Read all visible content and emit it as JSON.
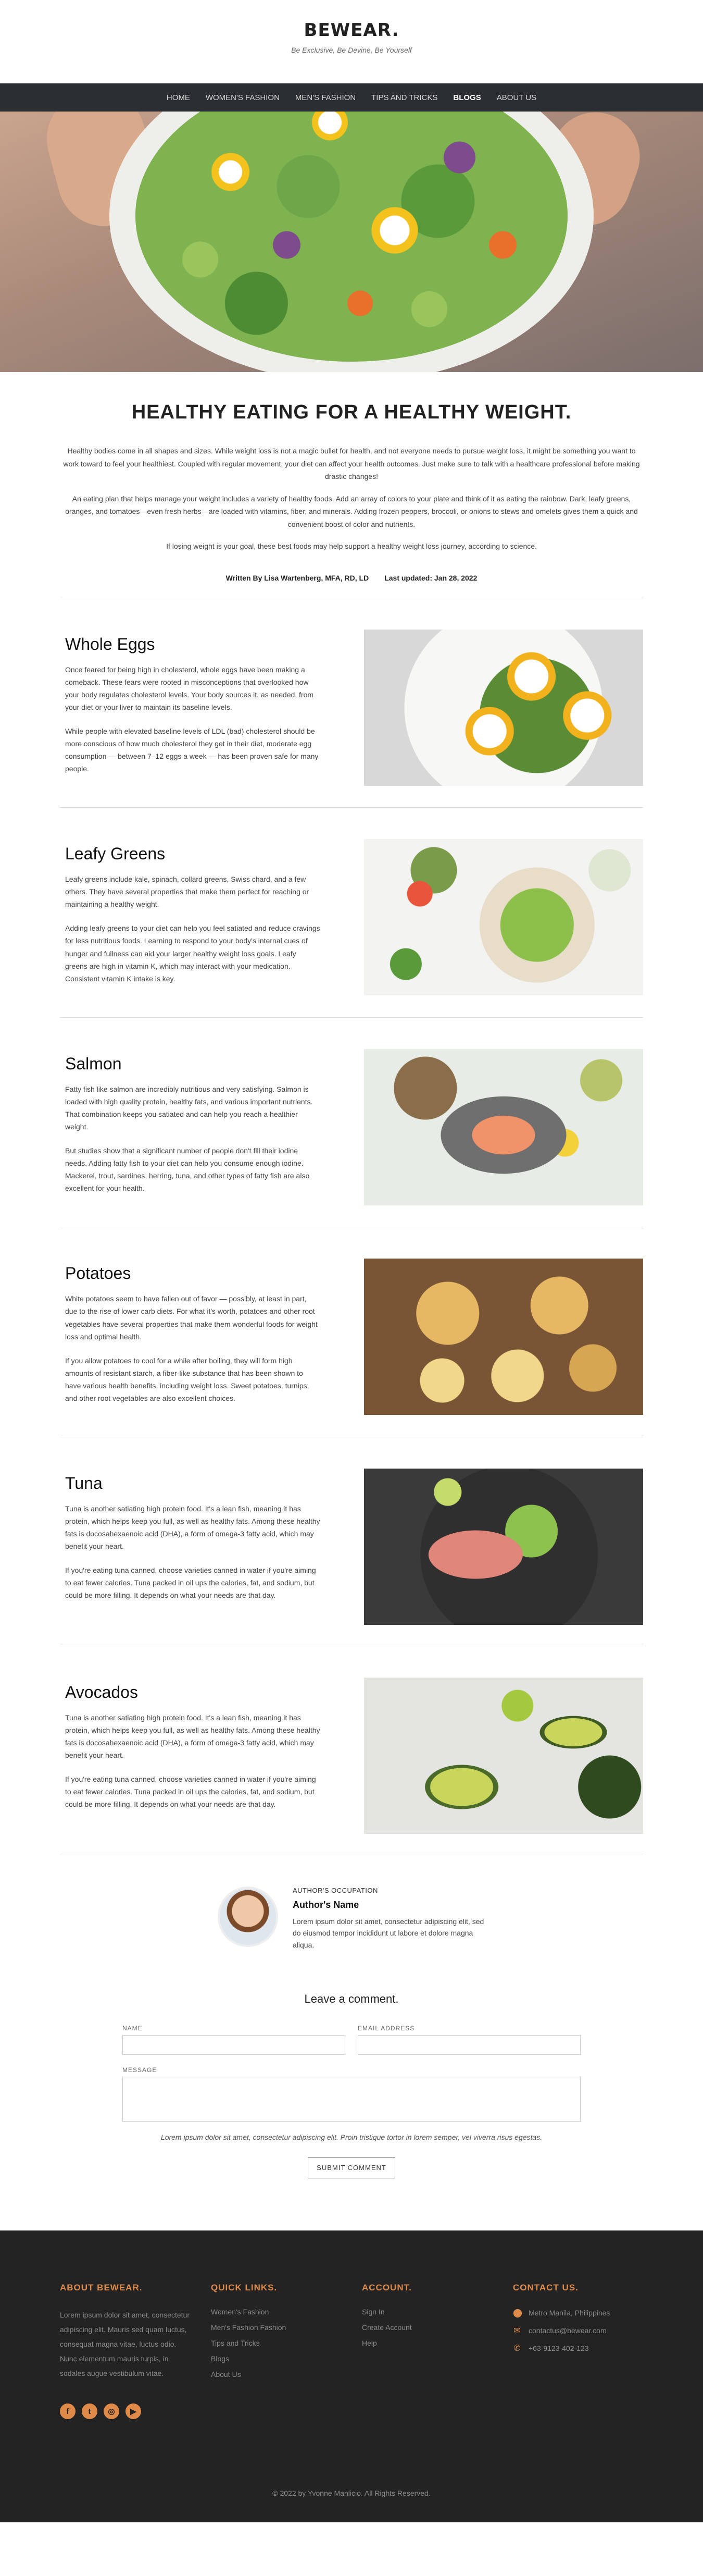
{
  "brand": {
    "title": "BEWEAR.",
    "tagline": "Be Exclusive, Be Devine, Be Yourself"
  },
  "nav": {
    "items": [
      {
        "label": "HOME"
      },
      {
        "label": "WOMEN'S FASHION"
      },
      {
        "label": "MEN'S FASHION"
      },
      {
        "label": "TIPS AND TRICKS"
      },
      {
        "label": "BLOGS"
      },
      {
        "label": "ABOUT US"
      }
    ],
    "active": "BLOGS"
  },
  "article": {
    "title": "HEALTHY EATING FOR A HEALTHY WEIGHT.",
    "paragraphs": [
      "Healthy bodies come in all shapes and sizes. While weight loss is not a magic bullet for health, and not everyone needs to pursue weight loss, it might be something you want to work toward to feel your healthiest. Coupled with regular movement, your diet can affect your health outcomes. Just make sure to talk with a healthcare professional before making drastic changes!",
      "An eating plan that helps manage your weight includes a variety of healthy foods. Add an array of colors to your plate and think of it as eating the rainbow. Dark, leafy greens, oranges, and tomatoes—even fresh herbs—are loaded with vitamins, fiber, and minerals. Adding frozen peppers, broccoli, or onions to stews and omelets gives them a quick and convenient boost of color and nutrients.",
      "If losing weight is your goal, these best foods may help support a healthy weight loss journey, according to science."
    ],
    "author": "Written By Lisa Wartenberg, MFA, RD, LD",
    "updated": "Last updated: Jan 28, 2022"
  },
  "foods": [
    {
      "title": "Whole Eggs",
      "p1": "Once feared for being high in cholesterol, whole eggs have been making a comeback. These fears were rooted in misconceptions that overlooked how your body regulates cholesterol levels. Your body sources it, as needed, from your diet or your liver to maintain its baseline levels.",
      "p2": "While people with elevated baseline levels of LDL (bad) cholesterol should be more conscious of how much cholesterol they get in their diet, moderate egg consumption — between 7–12 eggs a week — has been proven safe for many people."
    },
    {
      "title": "Leafy Greens",
      "p1": "Leafy greens include kale, spinach, collard greens, Swiss chard, and a few others. They have several properties that make them perfect for reaching or maintaining a healthy weight.",
      "p2": "Adding leafy greens to your diet can help you feel satiated and reduce cravings for less nutritious foods. Learning to respond to your body's internal cues of hunger and fullness can aid your larger healthy weight loss goals. Leafy greens are high in vitamin K, which may interact with your medication. Consistent vitamin K intake is key."
    },
    {
      "title": "Salmon",
      "p1": "Fatty fish like salmon are incredibly nutritious and very satisfying. Salmon is loaded with high quality protein, healthy fats, and various important nutrients. That combination keeps you satiated and can help you reach a healthier weight.",
      "p2": "But studies show that a significant number of people don't fill their iodine needs. Adding fatty fish to your diet can help you consume enough iodine. Mackerel, trout, sardines, herring, tuna, and other types of fatty fish are also excellent for your health."
    },
    {
      "title": "Potatoes",
      "p1": "White potatoes seem to have fallen out of favor — possibly, at least in part, due to the rise of lower carb diets. For what it's worth, potatoes and other root vegetables have several properties that make them wonderful foods for weight loss and optimal health.",
      "p2": "If you allow potatoes to cool for a while after boiling, they will form high amounts of resistant starch, a fiber-like substance that has been shown to have various health benefits, including weight loss. Sweet potatoes, turnips, and other root vegetables are also excellent choices."
    },
    {
      "title": "Tuna",
      "p1": "Tuna is another satiating high protein food. It's a lean fish, meaning it has protein, which helps keep you full, as well as healthy fats. Among these healthy fats is docosahexaenoic acid (DHA), a form of omega-3 fatty acid, which may benefit your heart.",
      "p2": "If you're eating tuna canned, choose varieties canned in water if you're aiming to eat fewer calories. Tuna packed in oil ups the calories, fat, and sodium, but could be more filling. It depends on what your needs are that day."
    },
    {
      "title": "Avocados",
      "p1": "Tuna is another satiating high protein food. It's a lean fish, meaning it has protein, which helps keep you full, as well as healthy fats. Among these healthy fats is docosahexaenoic acid (DHA), a form of omega-3 fatty acid, which may benefit your heart.",
      "p2": "If you're eating tuna canned, choose varieties canned in water if you're aiming to eat fewer calories. Tuna packed in oil ups the calories, fat, and sodium, but could be more filling. It depends on what your needs are that day."
    }
  ],
  "authorBox": {
    "occupation": "AUTHOR'S OCCUPATION",
    "name": "Author's Name",
    "bio": "Lorem ipsum dolor sit amet, consectetur adipiscing elit, sed do eiusmod tempor incididunt ut labore et dolore magna aliqua."
  },
  "comment": {
    "title": "Leave a comment.",
    "name_label": "NAME",
    "email_label": "EMAIL ADDRESS",
    "message_label": "MESSAGE",
    "note": "Lorem ipsum dolor sit amet, consectetur adipiscing elit. Proin tristique tortor in lorem semper, vel viverra risus egestas.",
    "submit": "SUBMIT COMMENT"
  },
  "footer": {
    "about_title": "ABOUT BEWEAR.",
    "about_text": "Lorem ipsum dolor sit amet, consectetur adipiscing elit. Mauris sed quam luctus, consequat magna vitae, luctus odio. Nunc elementum mauris turpis, in sodales augue vestibulum vitae.",
    "quick_title": "QUICK LINKS.",
    "quick_links": [
      "Women's Fashion",
      "Men's Fashion Fashion",
      "Tips and Tricks",
      "Blogs",
      "About Us"
    ],
    "account_title": "ACCOUNT.",
    "account_links": [
      "Sign In",
      "Create Account",
      "Help"
    ],
    "contact_title": "CONTACT US.",
    "contact": [
      {
        "icon": "location-pin-icon",
        "text": "Metro Manila, Philippines"
      },
      {
        "icon": "envelope-icon",
        "text": "contactus@bewear.com"
      },
      {
        "icon": "phone-icon",
        "text": "+63-9123-402-123"
      }
    ],
    "socials": [
      "facebook-icon",
      "twitter-icon",
      "instagram-icon",
      "youtube-icon"
    ],
    "copyright": "© 2022 by Yvonne Manlicio. All Rights Reserved.",
    "accent": "#e08a4a"
  }
}
